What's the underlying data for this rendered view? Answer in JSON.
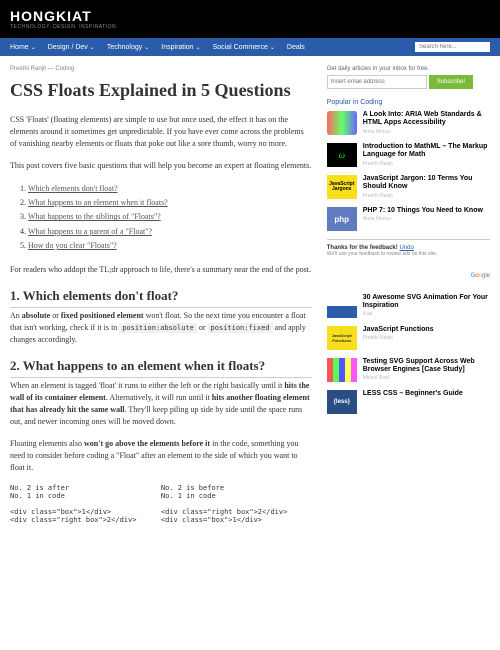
{
  "header": {
    "logo": "HONGKIAT",
    "tagline": "TECHNOLOGY. DESIGN. INSPIRATION."
  },
  "nav": {
    "items": [
      "Home",
      "Design / Dev",
      "Technology",
      "Inspiration",
      "Social Commerce",
      "Deals"
    ],
    "search_placeholder": "Search here..."
  },
  "breadcrumb": "Preethi Ranjit — Coding",
  "title": "CSS Floats Explained in 5 Questions",
  "intro1": "CSS 'Floats' (floating elements) are simple to use but once used, the effect it has on the elements around it sometimes get unpredictable. If you have ever come across the problems of vanishing nearby elements or floats that poke out like a sore thumb, worry no more.",
  "intro2": "This post covers five basic questions that will help you become an expert at floating elements.",
  "toc": [
    "Which elements don't float?",
    "What happens to an element when it floats?",
    "What happens to the siblings of \"Floats\"?",
    "What happens to a parent of a \"Float\"?",
    "How do you clear \"Floats\"?"
  ],
  "tldr": "For readers who addopt the TL;dr approach to life, there's a summary near the end of the post.",
  "h1": {
    "title": "1. Which elements don't float?",
    "p1_a": "An ",
    "p1_b": "absolute",
    "p1_c": " or ",
    "p1_d": "fixed positioned element",
    "p1_e": " won't float. So the next time you encounter a float that isn't working, check if it is in ",
    "code1": "position:absolute",
    "p1_f": " or ",
    "code2": "position:fixed",
    "p1_g": " and apply changes accordingly."
  },
  "h2": {
    "title": "2. What happens to an element when it floats?",
    "p1_a": "When an element is tagged 'float' it runs to either the left or the right basically until it ",
    "p1_b": "hits the wall of its container element",
    "p1_c": ". Alternatively, it will run until it ",
    "p1_d": "hits another floating element that has already hit the same wall",
    "p1_e": ". They'll keep piling up side by side until the space runs out, and newer incoming ones will be moved down.",
    "p2_a": "Floating elements also ",
    "p2_b": "won't go above the elements before it",
    "p2_c": " in the code, something you need to consider before coding a \"Float\" after an element to the side of which you want to float it.",
    "col1_h": "No. 2 is after\nNo. 1 in code",
    "col2_h": "No. 2 is before\nNo. 1 in code",
    "col1_c": "<div class=\"box\">1</div>\n<div class=\"right box\">2</div>",
    "col2_c": "<div class=\"right box\">2</div>\n<div class=\"box\">1</div>"
  },
  "sidebar": {
    "sub_label": "Get daily articles in your inbox for free.",
    "email_ph": "Insert email address",
    "sub_btn": "Subscribe!",
    "pop_head": "Popular in Coding",
    "items": [
      {
        "t": "A Look Into: ARIA Web Standards & HTML Apps Accessibility",
        "a": "Anna Monus",
        "c": "t-rainbow",
        "g": ""
      },
      {
        "t": "Introduction to MathML – The Markup Language for Math",
        "a": "Preethi Ranjit",
        "c": "t-math",
        "g": "ω"
      },
      {
        "t": "JavaScript Jargon: 10 Terms You Should Know",
        "a": "Preethi Ranjit",
        "c": "t-js",
        "g": "JavaScript Jargons"
      },
      {
        "t": "PHP 7: 10 Things You Need to Know",
        "a": "Anna Monus",
        "c": "t-php",
        "g": "php"
      }
    ],
    "feedback": {
      "thanks": "Thanks for the feedback! ",
      "undo": "Undo",
      "sub": "We'll use your feedback to review ads on this site."
    },
    "items2": [
      {
        "t": "30 Awesome SVG Animation For Your Inspiration",
        "a": "Kazi",
        "c": "t-svg",
        "g": ""
      },
      {
        "t": "JavaScript Functions",
        "a": "Preethi Ranjit",
        "c": "t-jsf",
        "g": "JavaScript Functions"
      },
      {
        "t": "Testing SVG Support Across Web Browser Engines [Case Study]",
        "a": "Michal Rost",
        "c": "t-test",
        "g": ""
      },
      {
        "t": "LESS CSS – Beginner's Guide",
        "a": "",
        "c": "t-less",
        "g": "{less}"
      }
    ]
  }
}
